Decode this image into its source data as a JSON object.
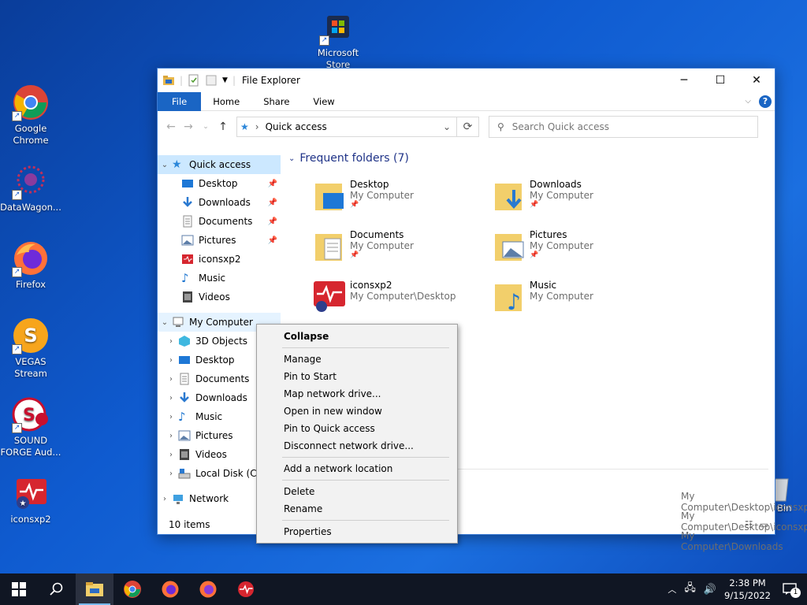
{
  "desktop": {
    "icons": [
      {
        "label": "Microsoft Store"
      },
      {
        "label": "Google Chrome"
      },
      {
        "label": "DataWagon..."
      },
      {
        "label": "Firefox"
      },
      {
        "label": "VEGAS Stream"
      },
      {
        "label": "SOUND FORGE Aud..."
      },
      {
        "label": "iconsxp2"
      }
    ],
    "recycle_label": "Bin"
  },
  "window": {
    "title": "File Explorer",
    "controls": {
      "minimize": "─",
      "maximize": "☐",
      "close": "✕"
    },
    "ribbon_tabs": [
      "File",
      "Home",
      "Share",
      "View"
    ],
    "address": {
      "location": "Quick access"
    },
    "search": {
      "placeholder": "Search Quick access"
    },
    "status": "10 items"
  },
  "sidebar": {
    "quick_access": {
      "label": "Quick access",
      "items": [
        {
          "label": "Desktop",
          "pinned": true,
          "color": "#1e78d6"
        },
        {
          "label": "Downloads",
          "pinned": true,
          "color": "#2a79d0"
        },
        {
          "label": "Documents",
          "pinned": true,
          "color": "#8c8c8c"
        },
        {
          "label": "Pictures",
          "pinned": true,
          "color": "#5d7ea8"
        },
        {
          "label": "iconsxp2",
          "pinned": false,
          "color": "#d6262f"
        },
        {
          "label": "Music",
          "pinned": false,
          "color": "#1f76d0"
        },
        {
          "label": "Videos",
          "pinned": false,
          "color": "#444444"
        }
      ]
    },
    "my_computer": {
      "label": "My Computer",
      "items": [
        {
          "label": "3D Objects"
        },
        {
          "label": "Desktop"
        },
        {
          "label": "Documents"
        },
        {
          "label": "Downloads"
        },
        {
          "label": "Music"
        },
        {
          "label": "Pictures"
        },
        {
          "label": "Videos"
        },
        {
          "label": "Local Disk (C:)"
        }
      ]
    },
    "network": {
      "label": "Network"
    }
  },
  "content": {
    "group_title": "Frequent folders (7)",
    "folders": [
      {
        "name": "Desktop",
        "path": "My Computer"
      },
      {
        "name": "Downloads",
        "path": "My Computer"
      },
      {
        "name": "Documents",
        "path": "My Computer"
      },
      {
        "name": "Pictures",
        "path": "My Computer"
      },
      {
        "name": "iconsxp2",
        "path": "My Computer\\Desktop"
      },
      {
        "name": "Music",
        "path": "My Computer"
      }
    ],
    "recent_paths": [
      "My Computer\\Desktop\\iconsxp2",
      "My Computer\\Desktop\\iconsxp2",
      "My Computer\\Downloads"
    ]
  },
  "context_menu": {
    "items": [
      "Collapse",
      "Manage",
      "Pin to Start",
      "Map network drive...",
      "Open in new window",
      "Pin to Quick access",
      "Disconnect network drive...",
      "Add a network location",
      "Delete",
      "Rename",
      "Properties"
    ]
  },
  "taskbar": {
    "time": "2:38 PM",
    "date": "9/15/2022",
    "notification_count": "1"
  },
  "colors": {
    "accent": "#1a65c4",
    "selection": "#cce8ff",
    "group_title": "#1e3287"
  }
}
